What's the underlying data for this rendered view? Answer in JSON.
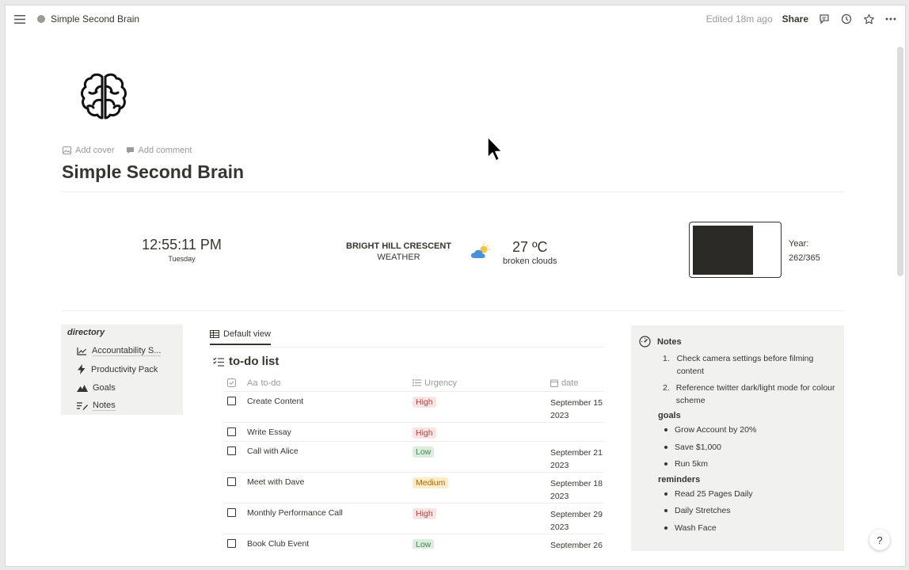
{
  "topbar": {
    "breadcrumb": "Simple Second Brain",
    "edited": "Edited 18m ago",
    "share_label": "Share"
  },
  "page": {
    "icon": "brain-icon",
    "add_cover": "Add cover",
    "add_comment": "Add comment",
    "title": "Simple Second Brain"
  },
  "clock": {
    "time": "12:55:11 PM",
    "day": "Tuesday"
  },
  "weather": {
    "location": "BRIGHT HILL CRESCENT",
    "label": "WEATHER",
    "temperature": "27 ºC",
    "condition": "broken clouds"
  },
  "year_progress": {
    "label": "Year:",
    "value": "262/365",
    "fraction": 0.718
  },
  "directory": {
    "title": "directory",
    "items": [
      {
        "label": "Accountability S...",
        "icon": "chart-icon"
      },
      {
        "label": "Productivity Pack",
        "icon": "lightning-icon"
      },
      {
        "label": "Goals",
        "icon": "mountain-icon"
      },
      {
        "label": "Notes",
        "icon": "pen-list-icon"
      }
    ]
  },
  "todo": {
    "view_tab": "Default view",
    "title": "to-do list",
    "columns": {
      "name": "to-do",
      "name_prefix": "Aa",
      "urgency": "Urgency",
      "date": "date"
    },
    "rows": [
      {
        "name": "Create Content",
        "urgency": "High",
        "urgency_class": "high",
        "date1": "September 15",
        "date2": "2023"
      },
      {
        "name": "Write Essay",
        "urgency": "High",
        "urgency_class": "high",
        "date1": "",
        "date2": ""
      },
      {
        "name": "Call with Alice",
        "urgency": "Low",
        "urgency_class": "low",
        "date1": "September 21",
        "date2": "2023"
      },
      {
        "name": "Meet with Dave",
        "urgency": "Medium",
        "urgency_class": "medium",
        "date1": "September 18",
        "date2": "2023"
      },
      {
        "name": "Monthly Performance Call",
        "urgency": "High",
        "urgency_class": "high",
        "date1": "September 29",
        "date2": "2023"
      },
      {
        "name": "Book Club Event",
        "urgency": "Low",
        "urgency_class": "low",
        "date1": "September 26",
        "date2": ""
      }
    ]
  },
  "notes": {
    "title": "Notes",
    "list": [
      "Check camera settings before filming content",
      "Reference twitter dark/light mode for colour scheme"
    ],
    "goals_title": "goals",
    "goals": [
      "Grow Account by 20%",
      "Save $1,000",
      "Run 5km"
    ],
    "reminders_title": "reminders",
    "reminders": [
      "Read 25 Pages Daily",
      "Daily Stretches",
      "Wash Face"
    ]
  },
  "help_label": "?"
}
